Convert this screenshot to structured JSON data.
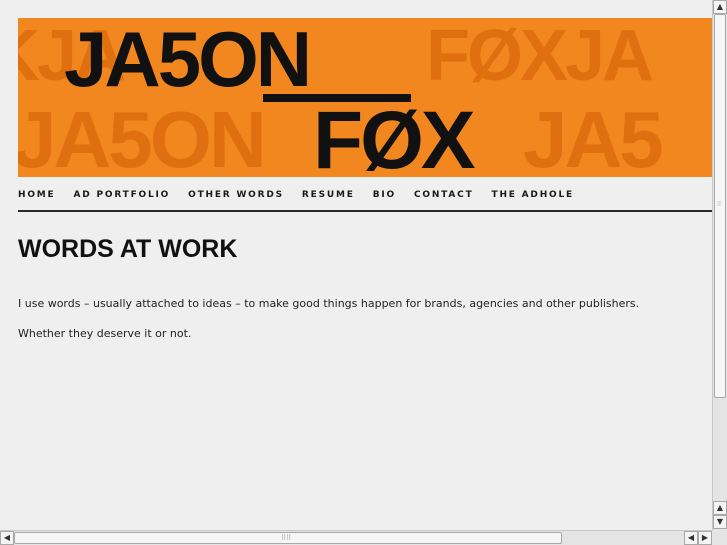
{
  "banner": {
    "name_first": "JA5ON",
    "name_last": "FØX",
    "bg_row1": "KJA",
    "bg_row1_right": "FØXJA",
    "bg_row2": "JA5ON",
    "bg_row2_right": "JA5",
    "colors": {
      "background": "#f2861f",
      "pattern": "#e06f10",
      "text": "#111111"
    }
  },
  "nav": {
    "items": [
      {
        "label": "HOME"
      },
      {
        "label": "AD PORTFOLIO"
      },
      {
        "label": "OTHER WORDS"
      },
      {
        "label": "RESUME"
      },
      {
        "label": "BIO"
      },
      {
        "label": "CONTACT"
      },
      {
        "label": "THE ADHOLE"
      }
    ]
  },
  "main": {
    "title": "WORDS AT WORK",
    "paragraphs": [
      "I use words – usually attached to ideas – to make good things happen for brands, agencies and other publishers.",
      "Whether they deserve it or not."
    ]
  },
  "scrollbars": {
    "up": "▲",
    "down": "▼",
    "left": "◀",
    "right": "▶"
  }
}
